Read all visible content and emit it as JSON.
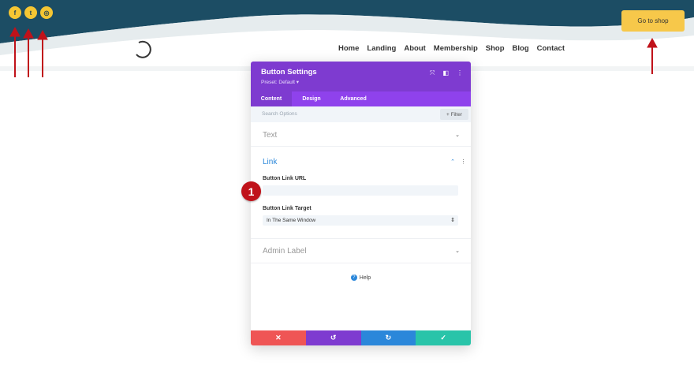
{
  "header": {
    "wave_color": "#1c4d64",
    "social": [
      {
        "icon": "facebook-icon",
        "glyph": "f"
      },
      {
        "icon": "twitter-icon",
        "glyph": "t"
      },
      {
        "icon": "instagram-icon",
        "glyph": "◎"
      }
    ],
    "shop_button": "Go to shop",
    "nav": [
      "Home",
      "Landing",
      "About",
      "Membership",
      "Shop",
      "Blog",
      "Contact"
    ]
  },
  "panel": {
    "title": "Button Settings",
    "preset": "Preset: Default ▾",
    "header_icons": [
      "expand-icon",
      "sidebar-icon",
      "more-icon"
    ],
    "tabs": [
      "Content",
      "Design",
      "Advanced"
    ],
    "active_tab": "Content",
    "search_placeholder": "Search Options",
    "filter_label": "+ Filter",
    "sections": {
      "text": "Text",
      "link": "Link",
      "admin": "Admin Label"
    },
    "link_url_label": "Button Link URL",
    "link_url_value": "",
    "link_target_label": "Button Link Target",
    "link_target_value": "In The Same Window",
    "help": "Help",
    "footer_colors": {
      "cancel": "#ef5555",
      "undo": "#7e3bd0",
      "redo": "#2b87da",
      "save": "#29c4a9"
    }
  },
  "marker": "1",
  "arrow_color": "#c0121a"
}
